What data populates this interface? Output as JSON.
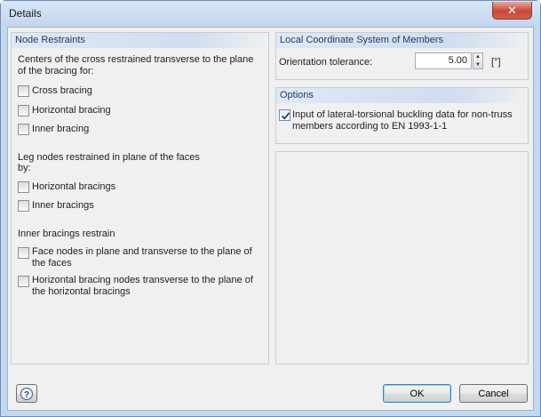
{
  "window": {
    "title": "Details",
    "close_label": "✕"
  },
  "node_restraints": {
    "header": "Node Restraints",
    "group1_text": [
      "Centers of the cross restrained transverse to the plane",
      "of the bracing for:"
    ],
    "group1_items": [
      {
        "label": "Cross bracing",
        "checked": false
      },
      {
        "label": "Horizontal bracing",
        "checked": false
      },
      {
        "label": "Inner bracing",
        "checked": false
      }
    ],
    "group2_text": [
      "Leg nodes restrained in plane of the faces",
      "by:"
    ],
    "group2_items": [
      {
        "label": "Horizontal bracings",
        "checked": false
      },
      {
        "label": "Inner bracings",
        "checked": false
      }
    ],
    "group3_text": "Inner bracings restrain",
    "group3_items": [
      {
        "label_lines": [
          "Face nodes in plane and transverse to the plane of",
          "the faces"
        ],
        "checked": false
      },
      {
        "label_lines": [
          "Horizontal bracing nodes transverse to the plane of",
          "the horizontal bracings"
        ],
        "checked": false
      }
    ]
  },
  "lcs": {
    "header": "Local Coordinate System of Members",
    "tolerance_label": "Orientation tolerance:",
    "tolerance_value": "5.00",
    "unit": "[°]"
  },
  "options": {
    "header": "Options",
    "ltb_label_lines": [
      "Input of lateral-torsional buckling data for non-truss",
      "members according to EN 1993-1-1"
    ],
    "ltb_checked": true
  },
  "footer": {
    "ok_label": "OK",
    "cancel_label": "Cancel"
  }
}
